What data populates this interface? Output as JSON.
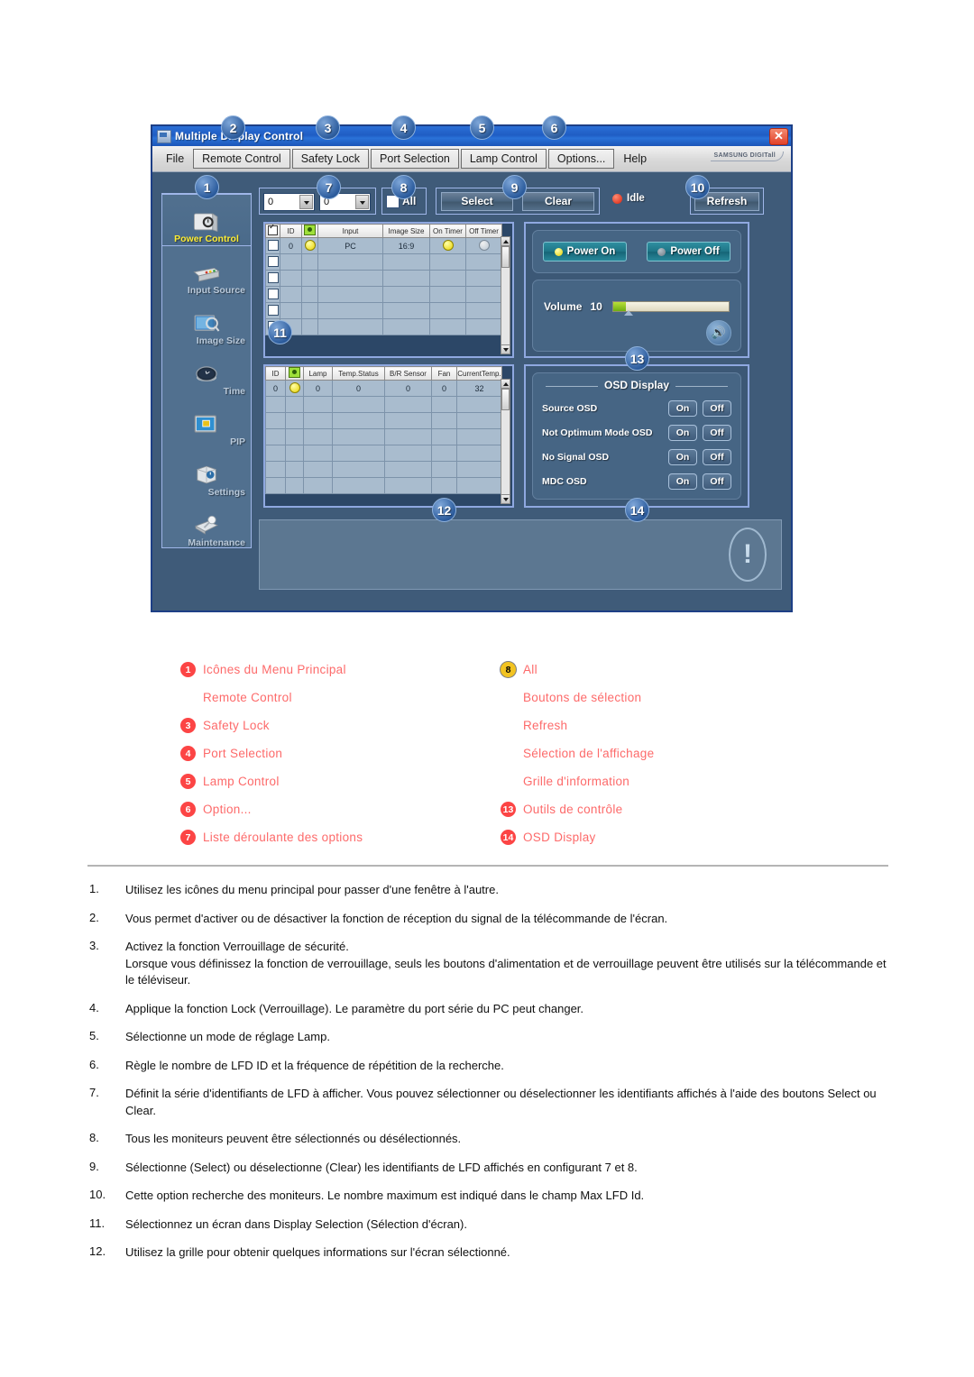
{
  "app": {
    "title": "Multiple Display Control",
    "close_label": "✕",
    "brand": "SAMSUNG DIGITall",
    "menus": [
      {
        "label": "File",
        "boxed": false
      },
      {
        "label": "Remote Control",
        "boxed": true
      },
      {
        "label": "Safety Lock",
        "boxed": true
      },
      {
        "label": "Port Selection",
        "boxed": true
      },
      {
        "label": "Lamp Control",
        "boxed": true
      },
      {
        "label": "Options...",
        "boxed": true
      },
      {
        "label": "Help",
        "boxed": false
      }
    ],
    "sidebar": [
      {
        "label": "Power Control",
        "active": true
      },
      {
        "label": "Input Source",
        "active": false
      },
      {
        "label": "Image Size",
        "active": false
      },
      {
        "label": "Time",
        "active": false
      },
      {
        "label": "PIP",
        "active": false
      },
      {
        "label": "Settings",
        "active": false
      },
      {
        "label": "Maintenance",
        "active": false
      }
    ],
    "toolbar": {
      "dropdown_from": "0",
      "dropdown_to": "0",
      "all_label": "All",
      "select_label": "Select",
      "clear_label": "Clear",
      "status_label": "Idle",
      "refresh_label": "Refresh"
    },
    "grid_top": {
      "headers": [
        "",
        "ID",
        "",
        "Input",
        "Image Size",
        "On Timer",
        "Off Timer"
      ],
      "rows": [
        {
          "id": "0",
          "lamp": "on",
          "input": "PC",
          "image_size": "16:9",
          "on_timer": "on",
          "off_timer": "off"
        }
      ],
      "empty_rows": 5
    },
    "grid_bottom": {
      "headers": [
        "ID",
        "",
        "Lamp",
        "Temp.Status",
        "B/R Sensor",
        "Fan",
        "CurrentTemp."
      ],
      "rows": [
        {
          "id": "0",
          "lamp_dot": "on",
          "lamp": "0",
          "temp_status": "0",
          "br_sensor": "0",
          "fan": "0",
          "current_temp": "32"
        }
      ],
      "empty_rows": 5
    },
    "power": {
      "on_label": "Power On",
      "off_label": "Power Off",
      "volume_label": "Volume",
      "volume_value": "10",
      "volume_percent": 10,
      "speaker_icon": "speaker-icon"
    },
    "osd": {
      "title": "OSD Display",
      "rows": [
        {
          "label": "Source OSD",
          "on": "On",
          "off": "Off"
        },
        {
          "label": "Not Optimum Mode OSD",
          "on": "On",
          "off": "Off"
        },
        {
          "label": "No Signal OSD",
          "on": "On",
          "off": "Off"
        },
        {
          "label": "MDC OSD",
          "on": "On",
          "off": "Off"
        }
      ]
    },
    "callouts": [
      "1",
      "2",
      "3",
      "4",
      "5",
      "6",
      "7",
      "8",
      "9",
      "10",
      "11",
      "12",
      "13",
      "14"
    ]
  },
  "legend": {
    "left": [
      {
        "num": "1",
        "text": "Icônes du Menu Principal",
        "style": "red"
      },
      {
        "num": "",
        "text": "Remote Control",
        "style": "blank"
      },
      {
        "num": "3",
        "text": "Safety Lock",
        "style": "red"
      },
      {
        "num": "4",
        "text": "Port Selection",
        "style": "red"
      },
      {
        "num": "5",
        "text": "Lamp Control",
        "style": "red"
      },
      {
        "num": "6",
        "text": "Option...",
        "style": "red"
      },
      {
        "num": "7",
        "text": "Liste déroulante des options",
        "style": "red"
      }
    ],
    "right": [
      {
        "num": "8",
        "text": "All",
        "style": "yellow"
      },
      {
        "num": "",
        "text": "Boutons de sélection",
        "style": "blank"
      },
      {
        "num": "",
        "text": "Refresh",
        "style": "blank"
      },
      {
        "num": "",
        "text": "Sélection de l'affichage",
        "style": "blank"
      },
      {
        "num": "",
        "text": "Grille d'information",
        "style": "blank"
      },
      {
        "num": "13",
        "text": "Outils de contrôle",
        "style": "red"
      },
      {
        "num": "14",
        "text": "OSD Display",
        "style": "red"
      }
    ]
  },
  "notes": [
    {
      "num": "1.",
      "line1": "Utilisez les icônes du menu principal pour passer d'une fenêtre à l'autre.",
      "line2": ""
    },
    {
      "num": "2.",
      "line1": "Vous permet d'activer ou de désactiver la fonction de réception du signal de la télécommande de l'écran.",
      "line2": ""
    },
    {
      "num": "3.",
      "line1": "Activez la fonction Verrouillage de sécurité.",
      "line2": "Lorsque vous définissez la fonction de verrouillage, seuls les boutons d'alimentation et de verrouillage peuvent être utilisés sur la télécommande et le téléviseur."
    },
    {
      "num": "4.",
      "line1": "Applique la fonction Lock (Verrouillage). Le paramètre du port série du PC peut changer.",
      "line2": ""
    },
    {
      "num": "5.",
      "line1": "Sélectionne un mode de réglage Lamp.",
      "line2": ""
    },
    {
      "num": "6.",
      "line1": "Règle le nombre de LFD ID et la fréquence de répétition de la recherche.",
      "line2": ""
    },
    {
      "num": "7.",
      "line1": "Définit la série d'identifiants de LFD à afficher. Vous pouvez sélectionner ou déselectionner les identifiants affichés à l'aide des boutons Select ou Clear.",
      "line2": ""
    },
    {
      "num": "8.",
      "line1": "Tous les moniteurs peuvent être sélectionnés ou désélectionnés.",
      "line2": ""
    },
    {
      "num": "9.",
      "line1": "Sélectionne (Select) ou déselectionne (Clear) les identifiants de LFD affichés en configurant 7 et 8.",
      "line2": ""
    },
    {
      "num": "10.",
      "line1": "Cette option recherche des moniteurs. Le nombre maximum est indiqué dans le champ Max LFD Id.",
      "line2": ""
    },
    {
      "num": "11.",
      "line1": "Sélectionnez un écran dans Display Selection (Sélection d'écran).",
      "line2": ""
    },
    {
      "num": "12.",
      "line1": "Utilisez la grille pour obtenir quelques informations sur l'écran sélectionné.",
      "line2": ""
    }
  ],
  "colors": {
    "titlebar": "#1f5dc4",
    "window_bg": "#3f5b79",
    "accent_border": "#8fa8e0",
    "active_label": "#ffee33",
    "legend_red": "#fd6a6a",
    "badge_red": "#fc4545",
    "badge_yellow": "#f2c321",
    "teal_button": "#1d7486",
    "led_idle": "#d51f0b"
  }
}
